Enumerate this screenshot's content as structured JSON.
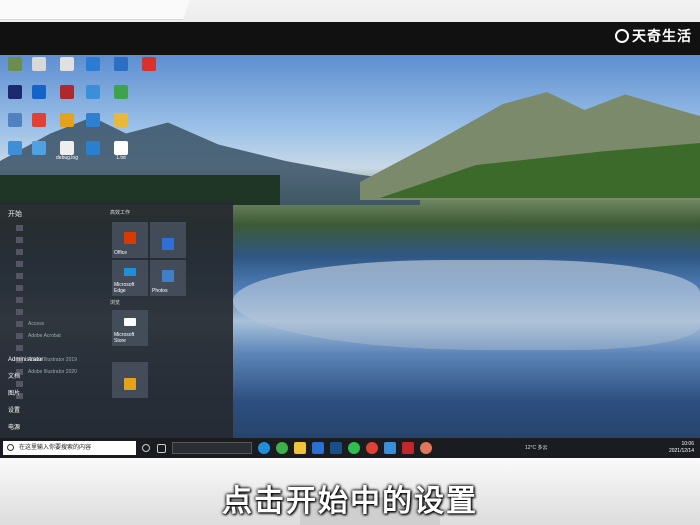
{
  "brand": {
    "watermark": "天奇生活",
    "watermark_big": "天奇"
  },
  "caption": "点击开始中的设置",
  "desktop_icons": [
    {
      "label": "",
      "color": "#6b8e4e"
    },
    {
      "label": "",
      "color": "#d8d8d8"
    },
    {
      "label": "",
      "color": "#e0e0e0"
    },
    {
      "label": "",
      "color": "#2c7bd4"
    },
    {
      "label": "",
      "color": "#2a6fc4"
    },
    {
      "label": "",
      "color": "#d9312b"
    },
    {
      "label": "",
      "color": "#1b2a6e"
    },
    {
      "label": "",
      "color": "#1463c8"
    },
    {
      "label": "",
      "color": "#b0282c"
    },
    {
      "label": "",
      "color": "#3a8fd8"
    },
    {
      "label": "",
      "color": "#3fa34d"
    },
    {
      "label": "",
      "color": "#5082c0"
    },
    {
      "label": "",
      "color": "#e04136"
    },
    {
      "label": "",
      "color": "#e3a21a"
    },
    {
      "label": "",
      "color": "#2f80d0"
    },
    {
      "label": "",
      "color": "#e8b83b"
    },
    {
      "label": "",
      "color": "#3f8fd8"
    },
    {
      "label": "",
      "color": "#4fa1e0"
    },
    {
      "label": "debug.log",
      "color": "#eeeeee"
    },
    {
      "label": "",
      "color": "#2a7fd0"
    },
    {
      "label": "1.txt",
      "color": "#ffffff"
    }
  ],
  "start_menu": {
    "title": "开始",
    "apps": [
      "",
      "",
      "",
      "",
      "",
      "",
      "",
      "",
      "Access",
      "Adobe Acrobat",
      "",
      "Adobe Illustrator 2019",
      "Adobe Illustrator 2020",
      "",
      ""
    ],
    "rail": [
      {
        "label": "Administrator"
      },
      {
        "label": "文档"
      },
      {
        "label": "图片"
      },
      {
        "label": "设置"
      },
      {
        "label": "电源"
      }
    ],
    "tiles_header": "高效工作",
    "tiles_header2": "浏览",
    "tiles": [
      {
        "label": "Office",
        "color": "#d83b01"
      },
      {
        "label": "",
        "color": "#2f6fd8"
      },
      {
        "label": "Microsoft Edge",
        "color": "#1f8fd8"
      },
      {
        "label": "Photos",
        "color": "#3f7fc8"
      },
      {
        "label": "Microsoft Store",
        "color": "#ffffff"
      },
      {
        "label": "",
        "color": "#e3a21a"
      }
    ]
  },
  "taskbar": {
    "search_placeholder": "在这里输入你要搜索的内容",
    "address_text": "",
    "weather": "12°C 多云",
    "time": "10:06",
    "date": "2021/12/14"
  },
  "colors": {
    "taskbar_bg": "#1a1c20",
    "start_bg": "#262a30"
  }
}
